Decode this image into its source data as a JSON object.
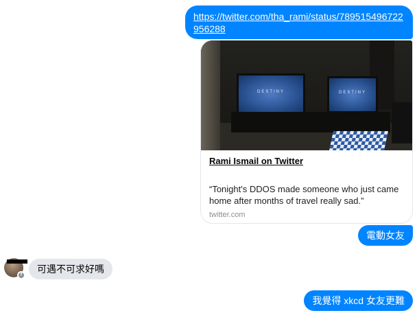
{
  "messages": {
    "link_text": "https://twitter.com/tha_rami/status/789515496722956288",
    "reply_1": "電動女友",
    "incoming": "可遇不可求好嗎",
    "reply_2": "我覺得 xkcd 女友更難"
  },
  "card": {
    "tv_logo": "DESTINY",
    "title": "Rami Ismail on Twitter",
    "quote": "“Tonight's DDOS made someone who just came home after months of travel really sad.”",
    "domain": "twitter.com"
  },
  "avatar": {
    "badge_icon": "facebook-icon",
    "badge_glyph": "f"
  },
  "colors": {
    "outgoing_bubble": "#0084ff",
    "incoming_bubble": "#e4e6eb",
    "link_text": "#ffffff"
  }
}
